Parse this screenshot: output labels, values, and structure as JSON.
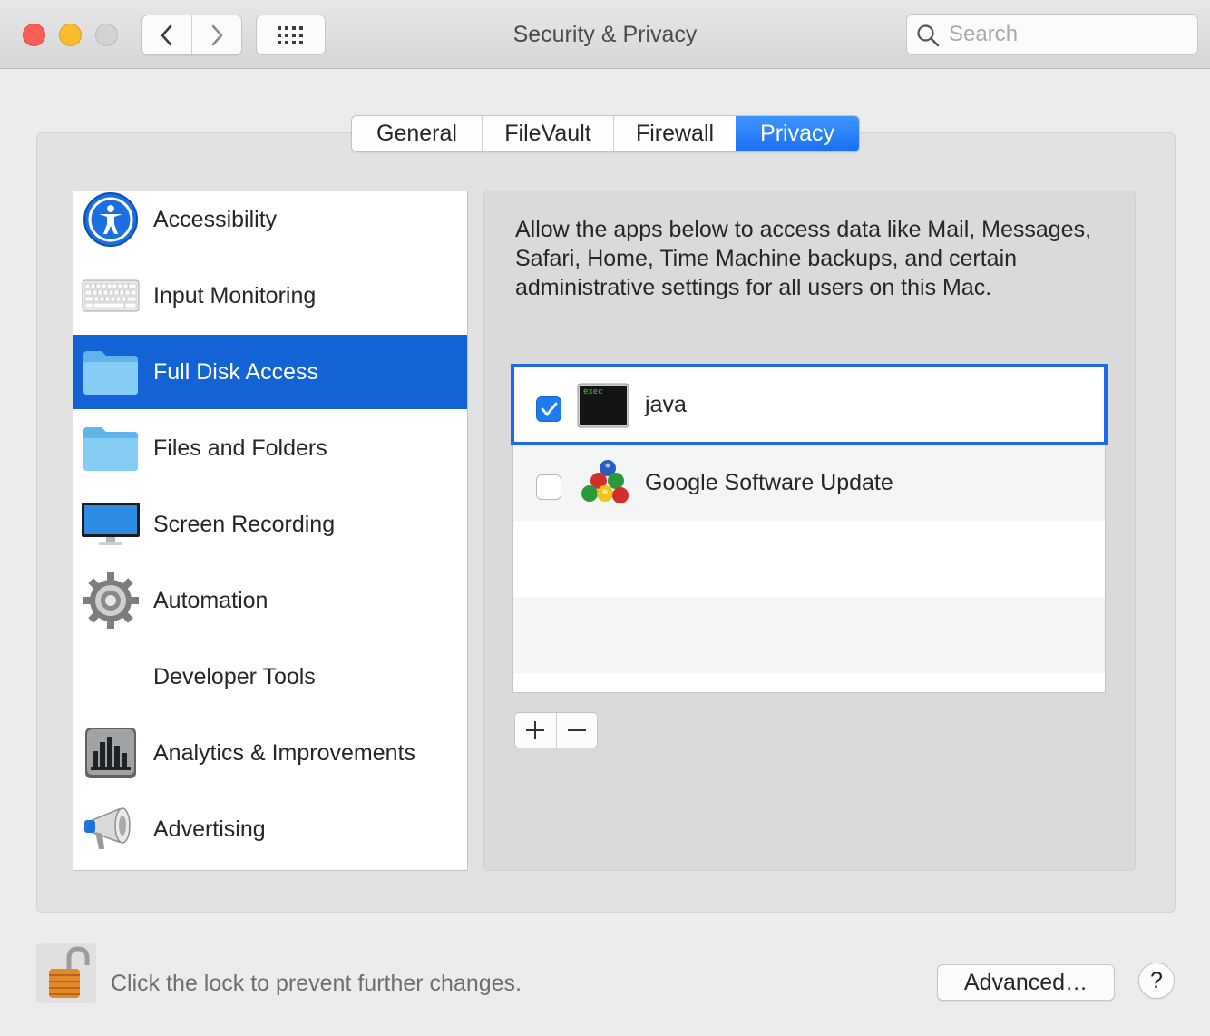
{
  "window": {
    "title": "Security & Privacy",
    "search_placeholder": "Search"
  },
  "tabs": [
    {
      "label": "General"
    },
    {
      "label": "FileVault"
    },
    {
      "label": "Firewall"
    },
    {
      "label": "Privacy",
      "selected": true
    }
  ],
  "sidebar": {
    "items": [
      {
        "label": "Accessibility",
        "icon": "accessibility-icon"
      },
      {
        "label": "Input Monitoring",
        "icon": "keyboard-icon"
      },
      {
        "label": "Full Disk Access",
        "icon": "folder-icon",
        "selected": true
      },
      {
        "label": "Files and Folders",
        "icon": "folder-icon"
      },
      {
        "label": "Screen Recording",
        "icon": "display-icon"
      },
      {
        "label": "Automation",
        "icon": "gear-icon"
      },
      {
        "label": "Developer Tools",
        "icon": ""
      },
      {
        "label": "Analytics & Improvements",
        "icon": "analytics-icon"
      },
      {
        "label": "Advertising",
        "icon": "megaphone-icon"
      }
    ]
  },
  "main": {
    "description": "Allow the apps below to access data like Mail, Messages, Safari, Home, Time Machine backups, and certain administrative settings for all users on this Mac.",
    "apps": [
      {
        "name": "java",
        "checked": true,
        "icon": "terminal-exec-icon",
        "icon_text": "exec"
      },
      {
        "name": "Google Software Update",
        "checked": false,
        "icon": "google-software-update-icon"
      }
    ]
  },
  "footer": {
    "lock_message": "Click the lock to prevent further changes.",
    "advanced_label": "Advanced…",
    "help_label": "?"
  },
  "colors": {
    "accent": "#1463d6",
    "tab_active": "#1a6ff3",
    "focus_ring": "#1b69f0",
    "close": "#fc5f57",
    "minimize": "#fdbc2e"
  }
}
